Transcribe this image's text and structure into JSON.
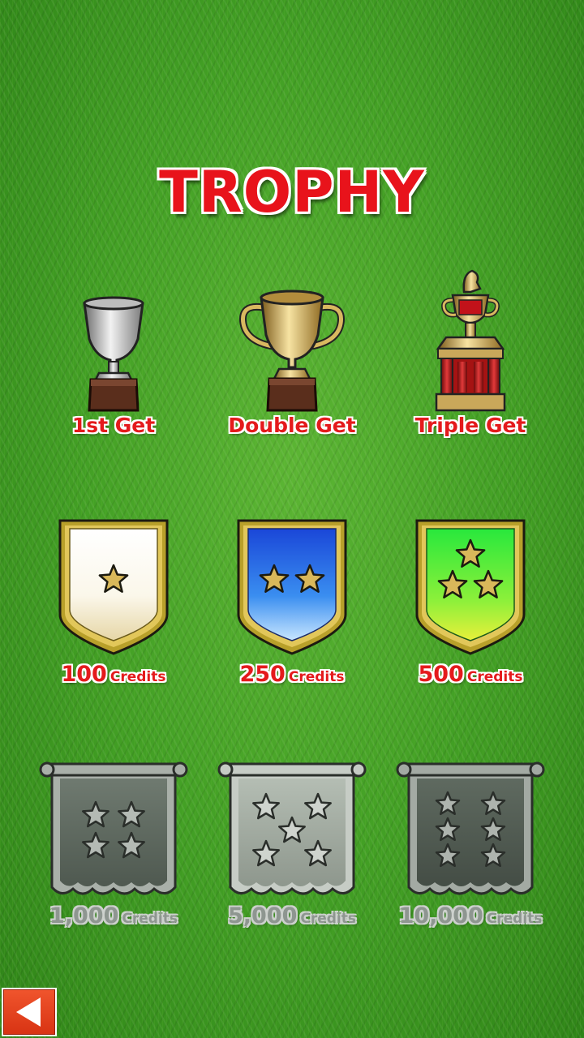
{
  "screen": {
    "title": "TROPHY"
  },
  "trophies": [
    {
      "label": "1st Get",
      "icon": "silver-cup-icon"
    },
    {
      "label": "Double Get",
      "icon": "gold-cup-icon"
    },
    {
      "label": "Triple Get",
      "icon": "tower-trophy-icon"
    }
  ],
  "shields": [
    {
      "amount": "100",
      "unit": "Credits",
      "stars": 1,
      "color": "#ffffff"
    },
    {
      "amount": "250",
      "unit": "Credits",
      "stars": 2,
      "color": "#2a64e0"
    },
    {
      "amount": "500",
      "unit": "Credits",
      "stars": 3,
      "color": "#3ee63a"
    }
  ],
  "banners": [
    {
      "amount": "1,000",
      "unit": "Credits",
      "stars": 4,
      "locked": true
    },
    {
      "amount": "5,000",
      "unit": "Credits",
      "stars": 5,
      "locked": true
    },
    {
      "amount": "10,000",
      "unit": "Credits",
      "stars": 6,
      "locked": true
    }
  ],
  "nav": {
    "back_icon": "back-arrow-icon",
    "back_color": "#e8431f"
  }
}
